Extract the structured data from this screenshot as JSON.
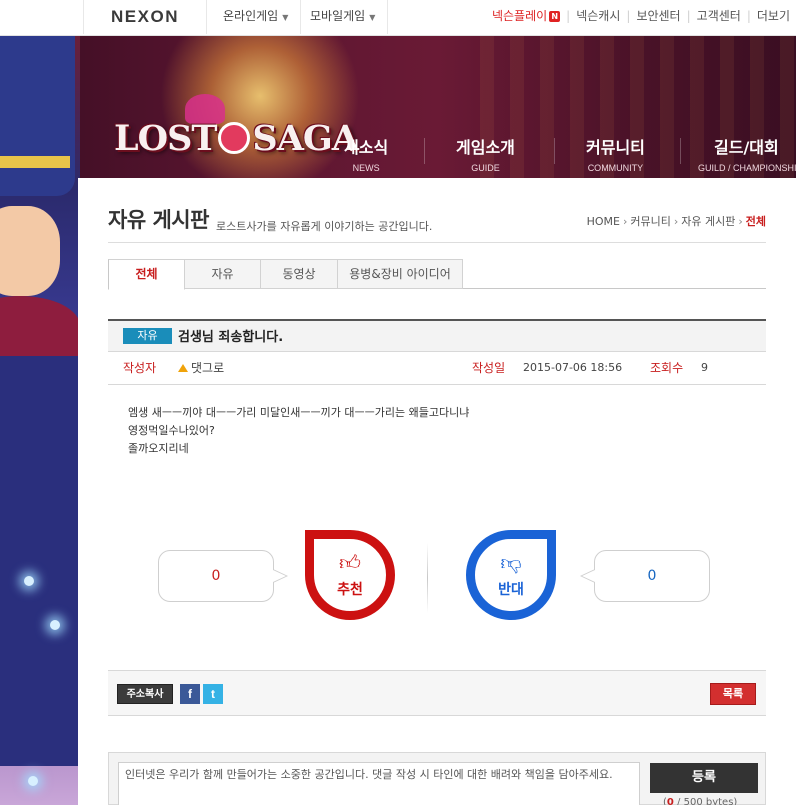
{
  "topbar": {
    "logo": "NEXON",
    "menus": [
      {
        "label": "온라인게임"
      },
      {
        "label": "모바일게임"
      }
    ],
    "util_links": [
      {
        "label": "넥슨플레이",
        "badge": "N"
      },
      {
        "label": "넥슨캐시"
      },
      {
        "label": "보안센터"
      },
      {
        "label": "고객센터"
      },
      {
        "label": "더보기"
      }
    ]
  },
  "game": {
    "logo_left": "LOST",
    "logo_right": "SAGA",
    "nav": [
      {
        "ko": "새소식",
        "en": "NEWS"
      },
      {
        "ko": "게임소개",
        "en": "GUIDE"
      },
      {
        "ko": "커뮤니티",
        "en": "COMMUNITY"
      },
      {
        "ko": "길드/대회",
        "en": "GUILD / CHAMPIONSHIP"
      }
    ]
  },
  "board": {
    "title": "자유 게시판",
    "description": "로스트사가를 자유롭게 이야기하는 공간입니다.",
    "breadcrumb": [
      "HOME",
      "커뮤니티",
      "자유 게시판",
      "전체"
    ],
    "tabs": [
      {
        "label": "전체",
        "active": true
      },
      {
        "label": "자유"
      },
      {
        "label": "동영상"
      },
      {
        "label": "용병&장비 아이디어"
      }
    ]
  },
  "post": {
    "category": "자유",
    "title": "검생님 죄송합니다.",
    "author_label": "작성자",
    "author": "댓그로",
    "date_label": "작성일",
    "date": "2015-07-06 18:56",
    "views_label": "조회수",
    "views": "9",
    "body": [
      "엠생 새ㅡㅡ끼야 대ㅡㅡ가리 미달인새ㅡㅡ끼가 대ㅡㅡ가리는 왜들고다니냐",
      "영정먹일수나있어?",
      "졸까오지리네"
    ]
  },
  "vote": {
    "up_label": "추천",
    "up_count": "0",
    "down_label": "반대",
    "down_count": "0",
    "colors": {
      "up": "#cc1111",
      "down": "#1a63d6"
    }
  },
  "actions": {
    "copy_url": "주소복사",
    "facebook": "f",
    "twitter": "t",
    "list": "목록"
  },
  "comment": {
    "placeholder": "인터넷은 우리가 함께 만들어가는 소중한 공간입니다. 댓글 작성 시 타인에 대한 배려와 책임을 담아주세요.",
    "submit": "등록",
    "byte_current": "0",
    "byte_rest": " / 500 bytes)",
    "byte_open": "("
  }
}
